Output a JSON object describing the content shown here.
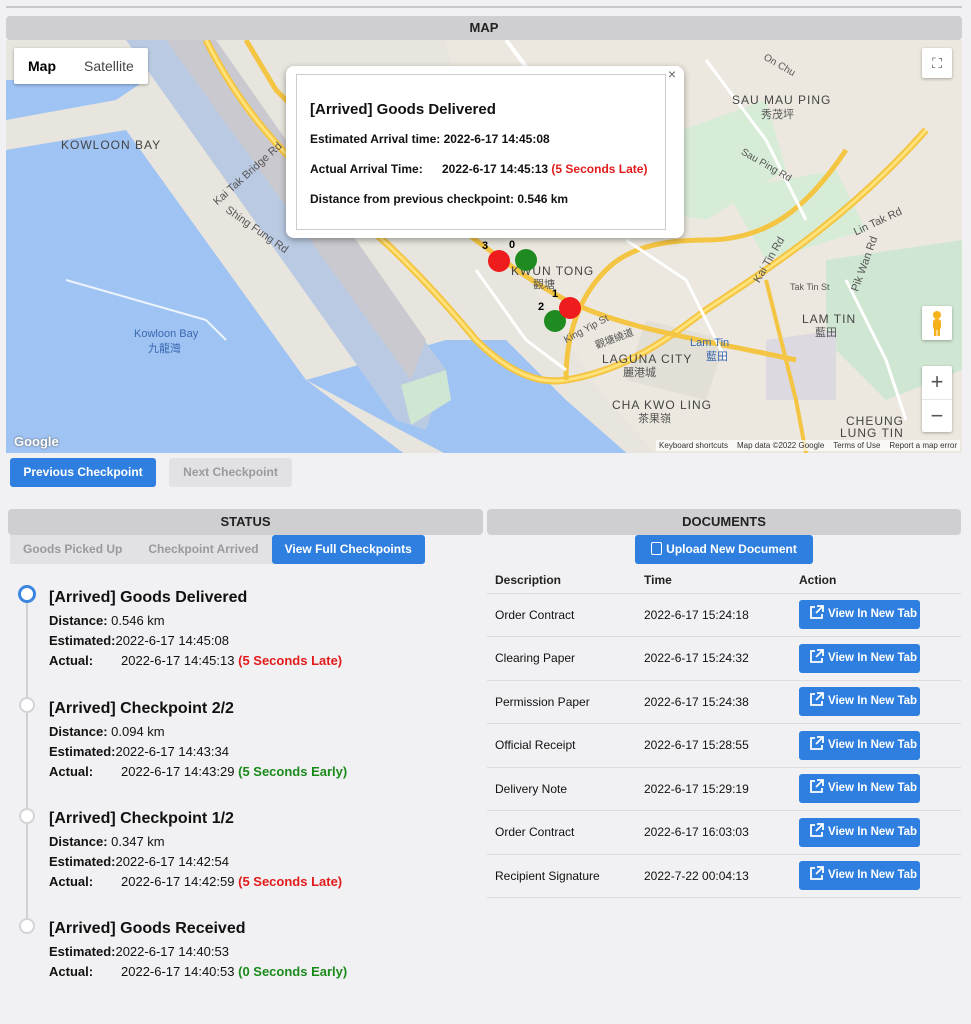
{
  "map": {
    "header": "MAP",
    "type_map": "Map",
    "type_satellite": "Satellite",
    "google": "Google",
    "attribution": [
      "Keyboard shortcuts",
      "Map data ©2022 Google",
      "Terms of Use",
      "Report a map error"
    ],
    "labels": {
      "kowloon_bay_en": "KOWLOON BAY",
      "kowloon_bay_water": "Kowloon Bay",
      "kowloon_bay_water_zh": "九龍灣",
      "sau_mau_ping": "SAU MAU PING",
      "sau_mau_ping_zh": "秀茂坪",
      "kwun_tong": "KWUN TONG",
      "kwun_tong_zh": "觀塘",
      "laguna_city": "LAGUNA CITY",
      "laguna_city_zh": "麗港城",
      "cha_kwo_ling": "CHA KWO LING",
      "cha_kwo_ling_zh": "茶果嶺",
      "lam_tin": "LAM TIN",
      "lam_tin_zh": "藍田",
      "lam_tin_station": "Lam Tin",
      "lam_tin_station_zh": "藍田",
      "cheung_lung_tin": "CHEUNG",
      "cheung_lung_tin2": "LUNG TIN",
      "lin_tak_rd": "Lin Tak Rd",
      "kai_tin_rd": "Kai Tin Rd",
      "pik_wan_rd": "Pik Wan Rd",
      "kai_tak_bridge_rd": "Kai Tak Bridge Rd",
      "shing_fung_rd": "Shing Fung Rd",
      "king_yip_st": "King Yip St",
      "kwun_tong_bypass_zh": "觀塘繞道",
      "sau_ping_rd": "Sau Ping Rd",
      "on_chu": "On Chu",
      "tak_tin_st": "Tak Tin St"
    },
    "markers": [
      {
        "label": "3",
        "color": "red"
      },
      {
        "label": "0",
        "color": "green"
      },
      {
        "label": "2",
        "color": "green"
      },
      {
        "label": "1",
        "color": "red"
      }
    ],
    "popup": {
      "title": "[Arrived] Goods Delivered",
      "estimated": "Estimated Arrival time: 2022-6-17 14:45:08",
      "actual_label": "Actual Arrival Time:",
      "actual_value": "2022-6-17 14:45:13",
      "actual_note": "(5 Seconds Late)",
      "distance": "Distance from previous checkpoint: 0.546 km",
      "close": "×"
    },
    "previous_label": "Previous Checkpoint",
    "next_label": "Next Checkpoint"
  },
  "status": {
    "header": "STATUS",
    "tabs": [
      "Goods Picked Up",
      "Checkpoint Arrived",
      "View Full Checkpoints"
    ],
    "checkpoints": [
      {
        "title": "[Arrived] Goods Delivered",
        "distance_label": "Distance:",
        "distance": "0.546 km",
        "estimated_label": "Estimated:",
        "estimated": "2022-6-17 14:45:08",
        "actual_label": "Actual:",
        "actual": "2022-6-17 14:45:13",
        "note": "(5 Seconds Late)"
      },
      {
        "title": "[Arrived] Checkpoint 2/2",
        "distance_label": "Distance:",
        "distance": "0.094 km",
        "estimated_label": "Estimated:",
        "estimated": "2022-6-17 14:43:34",
        "actual_label": "Actual:",
        "actual": "2022-6-17 14:43:29",
        "note": "(5 Seconds Early)"
      },
      {
        "title": "[Arrived] Checkpoint 1/2",
        "distance_label": "Distance:",
        "distance": "0.347 km",
        "estimated_label": "Estimated:",
        "estimated": "2022-6-17 14:42:54",
        "actual_label": "Actual:",
        "actual": "2022-6-17 14:42:59",
        "note": "(5 Seconds Late)"
      },
      {
        "title": "[Arrived] Goods Received",
        "estimated_label": "Estimated:",
        "estimated": "2022-6-17 14:40:53",
        "actual_label": "Actual:",
        "actual": "2022-6-17 14:40:53",
        "note": "(0 Seconds Early)"
      }
    ]
  },
  "documents": {
    "header": "DOCUMENTS",
    "upload_label": "Upload New Document",
    "columns": [
      "Description",
      "Time",
      "Action"
    ],
    "action_label": "View In New Tab",
    "rows": [
      {
        "description": "Order Contract",
        "time": "2022-6-17 15:24:18"
      },
      {
        "description": "Clearing Paper",
        "time": "2022-6-17 15:24:32"
      },
      {
        "description": "Permission Paper",
        "time": "2022-6-17 15:24:38"
      },
      {
        "description": "Official Receipt",
        "time": "2022-6-17 15:28:55"
      },
      {
        "description": "Delivery Note",
        "time": "2022-6-17 15:29:19"
      },
      {
        "description": "Order Contract",
        "time": "2022-6-17 16:03:03"
      },
      {
        "description": "Recipient Signature",
        "time": "2022-7-22 00:04:13"
      }
    ]
  },
  "colors": {
    "accent": "#2f7fe0",
    "late": "#e31b1b",
    "early": "#1a8a1a",
    "marker_red": "#ee1c1c",
    "marker_green": "#1f8a1f"
  }
}
